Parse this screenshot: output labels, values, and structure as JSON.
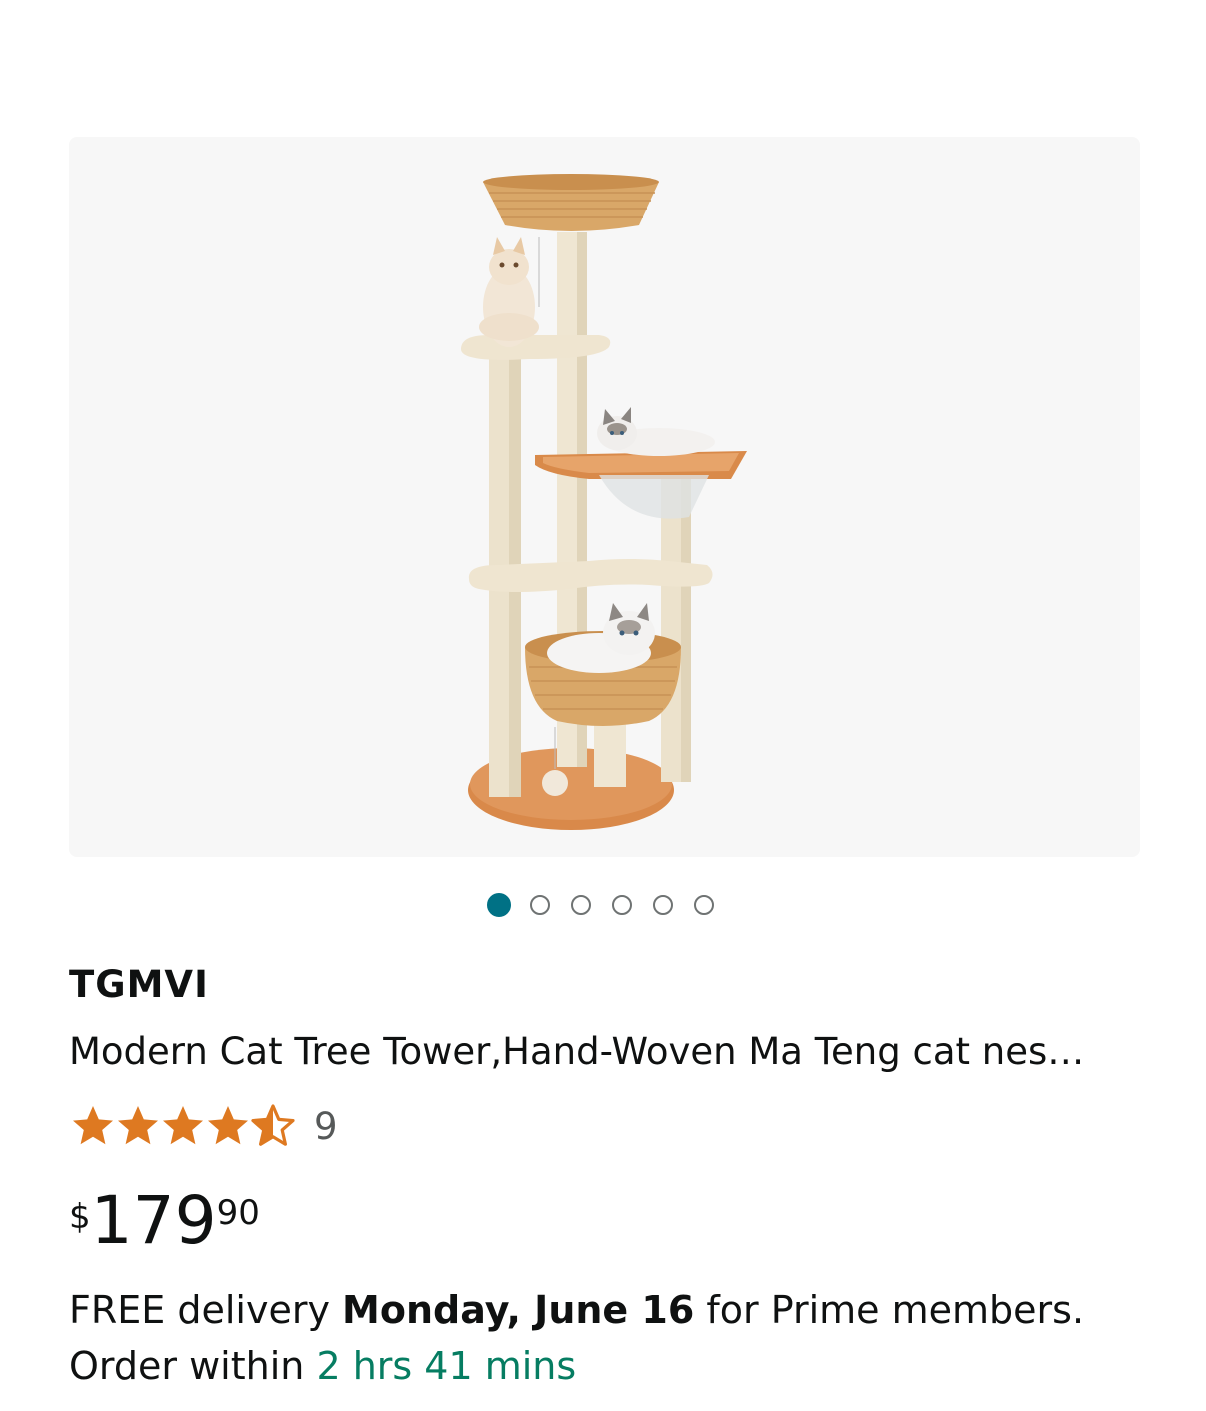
{
  "product": {
    "image_alt": "Cat tree tower product photo",
    "image_count": 6,
    "active_image": 1,
    "brand": "TGMVI",
    "title": "Modern Cat Tree Tower,Hand-Woven Ma Teng cat nes…",
    "rating": 4.5,
    "review_count": "9",
    "price": {
      "symbol": "$",
      "whole": "179",
      "fraction": "90"
    },
    "delivery": {
      "prefix": "FREE delivery",
      "date": "Monday, June 16",
      "suffix": "for Prime members.",
      "order_prefix": "Order within",
      "countdown": "2 hrs 41 mins"
    }
  },
  "colors": {
    "accent_teal": "#007185",
    "star_orange": "#de7921",
    "countdown_green": "#067d62",
    "gallery_bg": "#f7f7f7"
  },
  "icons": {
    "star": "star-icon",
    "half_star": "half-star-icon"
  }
}
